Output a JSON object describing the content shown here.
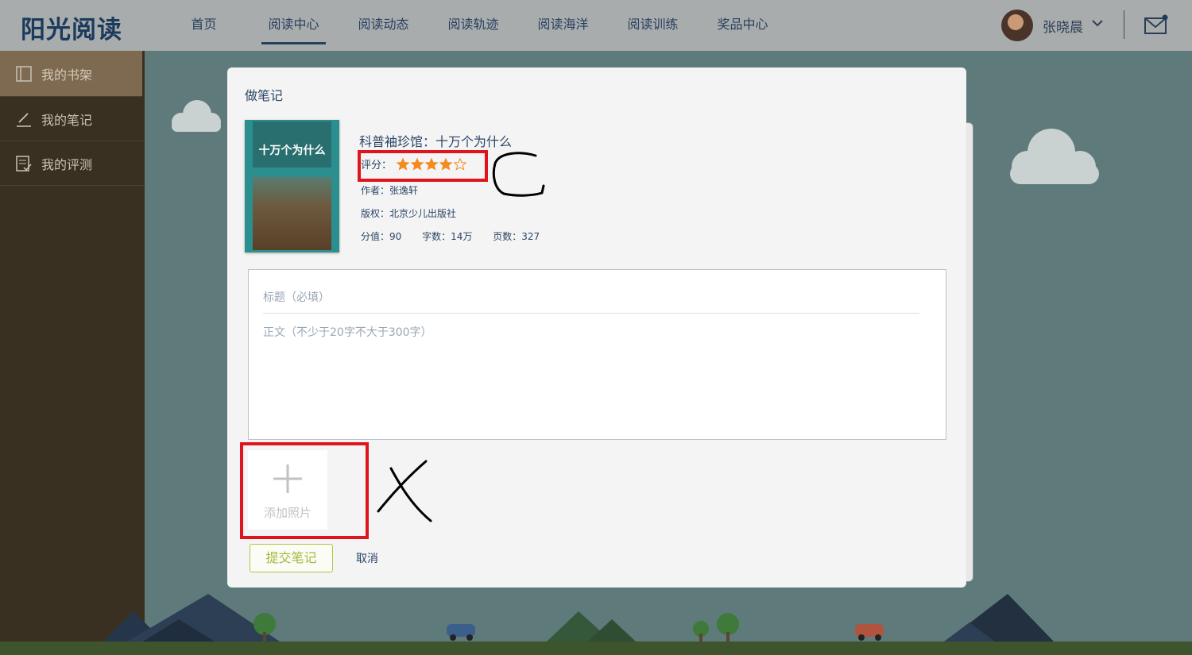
{
  "app": {
    "logo": "阳光阅读"
  },
  "nav": {
    "items": [
      "首页",
      "阅读中心",
      "阅读动态",
      "阅读轨迹",
      "阅读海洋",
      "阅读训练",
      "奖品中心"
    ],
    "active_index": 1
  },
  "user": {
    "name": "张晓晨"
  },
  "sidebar": {
    "items": [
      {
        "label": "我的书架",
        "icon": "bookshelf-icon"
      },
      {
        "label": "我的笔记",
        "icon": "pencil-icon"
      },
      {
        "label": "我的评测",
        "icon": "quiz-icon"
      }
    ]
  },
  "modal": {
    "title": "做笔记",
    "book": {
      "cover_title": "十万个为什么",
      "title": "科普袖珍馆：十万个为什么",
      "rating_label": "评分：",
      "rating": 4,
      "rating_max": 5,
      "author": "作者：张逸轩",
      "publisher": "版权：北京少儿出版社",
      "points": "分值：90",
      "words": "字数：14万",
      "pages": "页数：327"
    },
    "title_placeholder": "标题（必填）",
    "body_placeholder": "正文（不少于20字不大于300字）",
    "add_photo_label": "添加照片",
    "submit_label": "提交笔记",
    "cancel_label": "取消"
  },
  "colors": {
    "annotation": "#e0141c",
    "star": "#f58a1f",
    "submit_accent": "#a5b83a"
  }
}
